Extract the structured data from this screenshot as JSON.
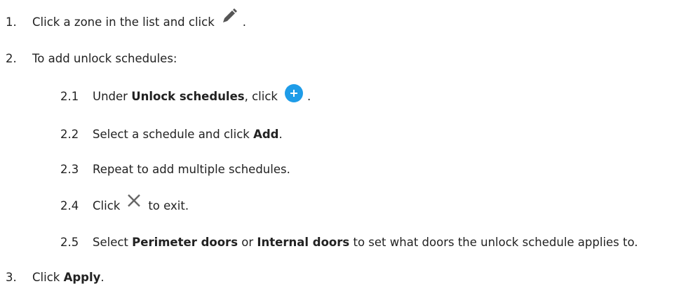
{
  "steps": {
    "s1": {
      "number": "1.",
      "before": "Click a zone in the list and click",
      "after": ".",
      "icon": "pencil-icon"
    },
    "s2": {
      "number": "2.",
      "text": "To add unlock schedules:"
    },
    "s2_1": {
      "number": "2.1",
      "before": "Under ",
      "bold": "Unlock schedules",
      "after_bold": ", click",
      "after": ".",
      "icon": "add-circle-icon"
    },
    "s2_2": {
      "number": "2.2",
      "before": "Select a schedule and click ",
      "bold": "Add",
      "after": "."
    },
    "s2_3": {
      "number": "2.3",
      "text": "Repeat to add multiple schedules."
    },
    "s2_4": {
      "number": "2.4",
      "before": "Click",
      "after": "to exit.",
      "icon": "close-icon"
    },
    "s2_5": {
      "number": "2.5",
      "before": "Select ",
      "bold1": "Perimeter doors",
      "middle": " or ",
      "bold2": "Internal doors",
      "after": " to set what doors the unlock schedule applies to."
    },
    "s3": {
      "number": "3.",
      "before": "Click ",
      "bold": "Apply",
      "after": "."
    }
  },
  "colors": {
    "text": "#222222",
    "pencil_icon": "#555555",
    "add_icon": "#1e9ce8",
    "close_icon": "#666666"
  }
}
